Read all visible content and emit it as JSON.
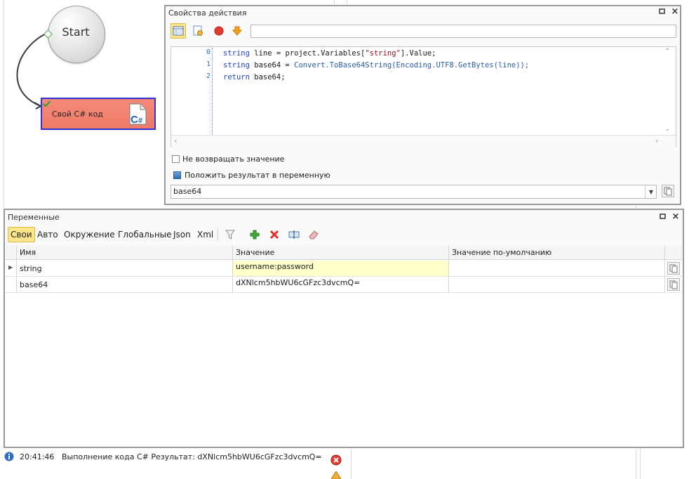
{
  "canvas": {
    "start_label": "Start",
    "action_label": "Свой C# код"
  },
  "properties": {
    "title": "Свойства действия",
    "code_lines": [
      {
        "num": "0",
        "text": "string line = project.Variables[\"string\"].Value;"
      },
      {
        "num": "1",
        "text": "string base64 = Convert.ToBase64String(Encoding.UTF8.GetBytes(line));"
      },
      {
        "num": "2",
        "text": "return base64;"
      }
    ],
    "no_return_label": "Не возвращать значение",
    "put_result_label": "Положить результат в переменную",
    "result_variable": "base64"
  },
  "variables": {
    "title": "Переменные",
    "tabs": [
      "Свои",
      "Авто",
      "Окружение",
      "Глобальные",
      "Json",
      "Xml"
    ],
    "columns": [
      "Имя",
      "Значение",
      "Значение по-умолчанию"
    ],
    "rows": [
      {
        "name": "string",
        "value": "username:password",
        "default": ""
      },
      {
        "name": "base64",
        "value": "dXNlcm5hbWU6cGFzc3dvcmQ=",
        "default": ""
      }
    ]
  },
  "log": {
    "time": "20:41:46",
    "message": "Выполнение кода C#  Результат: dXNlcm5hbWU6cGFzc3dvcmQ="
  },
  "colors": {
    "action_fill": "#f07a68",
    "action_border": "#2b33d9",
    "active_tab": "#fde68a",
    "highlight_cell": "#ffffcc"
  }
}
